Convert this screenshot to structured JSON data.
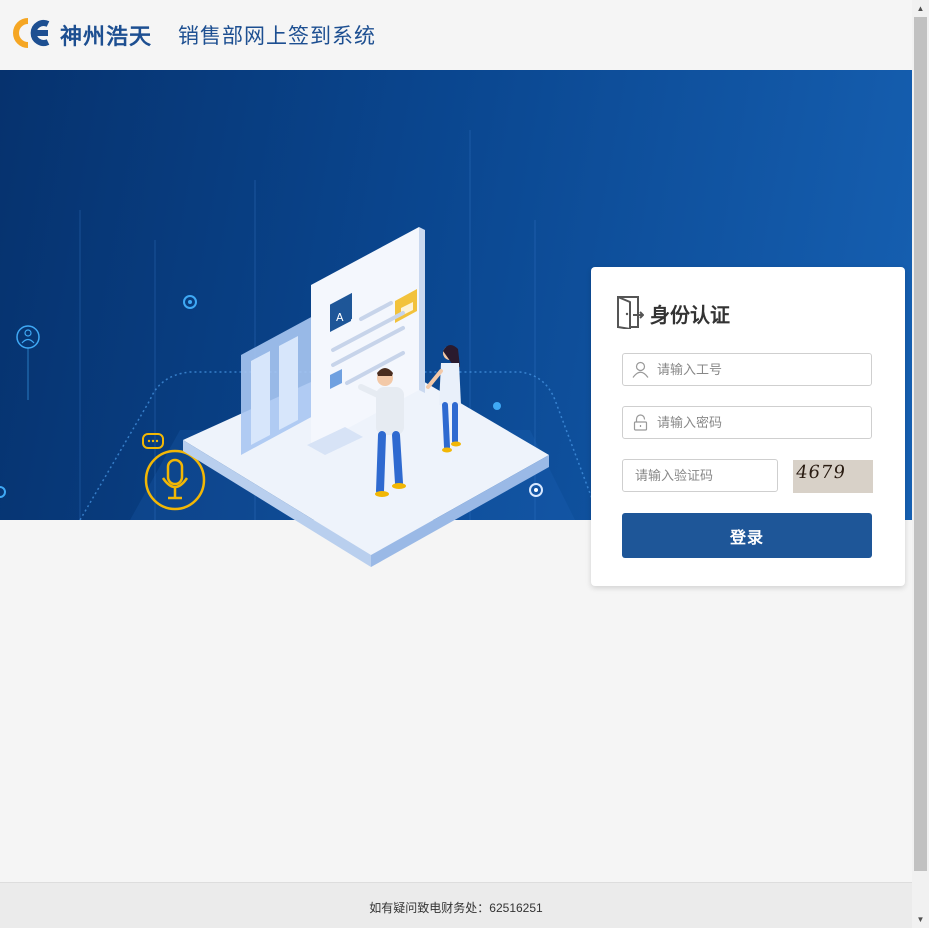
{
  "header": {
    "company_name": "神州浩天",
    "system_name": "销售部网上签到系统"
  },
  "login": {
    "title": "身份认证",
    "username_placeholder": "请输入工号",
    "password_placeholder": "请输入密码",
    "captcha_placeholder": "请输入验证码",
    "captcha_text": "4679",
    "submit_label": "登录"
  },
  "footer": {
    "contact_text": "如有疑问致电财务处：62516251"
  },
  "colors": {
    "brand_blue": "#1d4f91",
    "button_blue": "#1e5698",
    "banner_dark": "#06326e",
    "banner_light": "#1660b2",
    "logo_orange": "#f5a623"
  },
  "icons": {
    "logo": "company-logo",
    "door": "door-exit-icon",
    "user": "user-icon",
    "lock": "lock-icon",
    "microphone": "microphone-icon"
  }
}
